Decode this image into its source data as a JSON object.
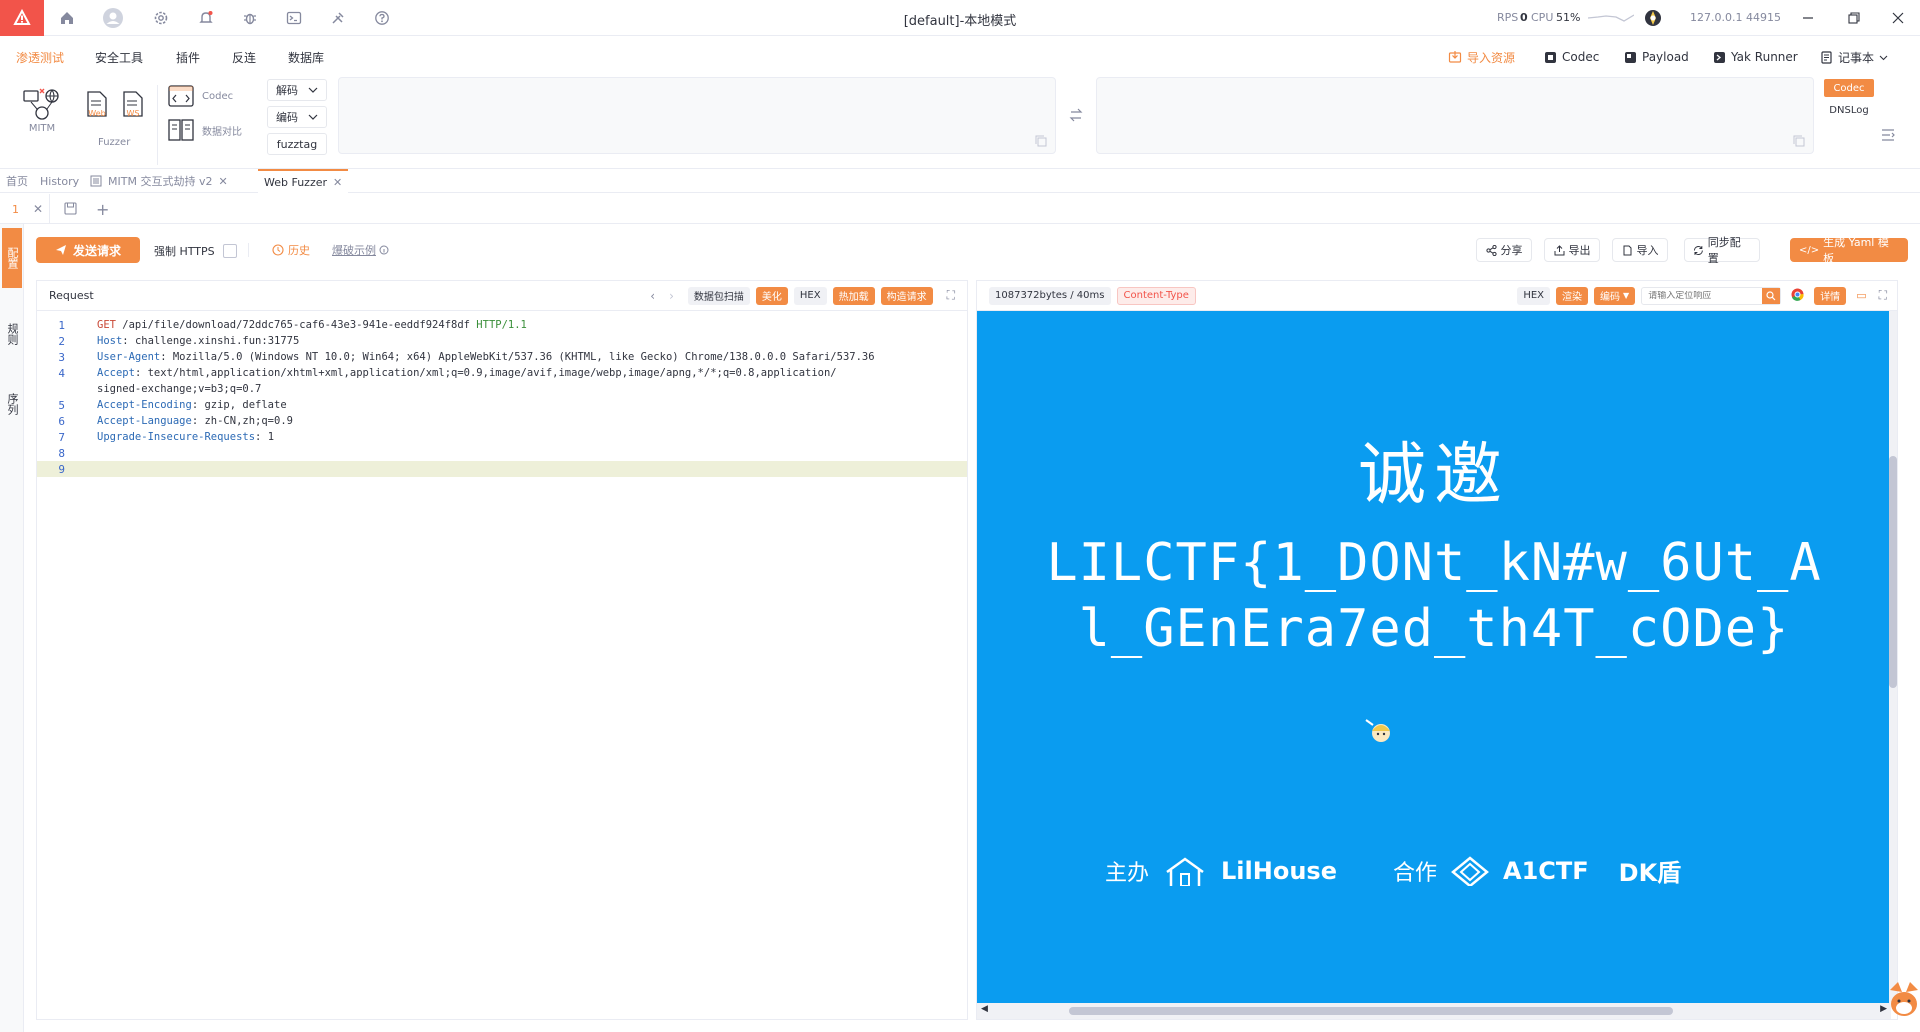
{
  "window": {
    "title": "[default]-本地模式",
    "rps_label": "RPS",
    "rps_value": "0",
    "cpu_label": "CPU",
    "cpu_value": "51%",
    "ip_port": "127.0.0.1 44915"
  },
  "menu": {
    "items": [
      "渗透测试",
      "安全工具",
      "插件",
      "反连",
      "数据库"
    ],
    "right": [
      "导入资源",
      "Codec",
      "Payload",
      "Yak Runner",
      "记事本"
    ]
  },
  "toolbar": {
    "mitm_label": "MITM",
    "web_label": "Web",
    "ws_label": "WS",
    "fuzzer_label": "Fuzzer",
    "codec_label": "Codec",
    "compare_label": "数据对比",
    "decode_label": "解码",
    "encode_label": "编码",
    "fuzztag_label": "fuzztag",
    "codec_tag": "Codec",
    "dnslog_tag": "DNSLog"
  },
  "page_tabs": [
    "首页",
    "History",
    "MITM 交互式劫持 v2",
    "Web Fuzzer"
  ],
  "sub_tabs": {
    "current": "1"
  },
  "sidebar": [
    "配置",
    "规则",
    "序列"
  ],
  "actions": {
    "send": "发送请求",
    "force_https": "强制 HTTPS",
    "history": "历史",
    "blast_example": "爆破示例",
    "share": "分享",
    "export": "导出",
    "import": "导入",
    "sync_config": "同步配置",
    "gen_yaml": "生成 Yaml 模板"
  },
  "request": {
    "title": "Request",
    "tags": [
      "数据包扫描",
      "美化",
      "HEX",
      "热加载",
      "构造请求"
    ],
    "lines": [
      {
        "n": "1",
        "key": "GET",
        "val": " /api/file/download/72ddc765-caf6-43e3-941e-eeddf924f8df ",
        "extra": "HTTP/1.1"
      },
      {
        "n": "2",
        "key": "Host",
        "val": ": challenge.xinshi.fun:31775",
        "extra": ""
      },
      {
        "n": "3",
        "key": "User-Agent",
        "val": ": Mozilla/5.0 (Windows NT 10.0; Win64; x64) AppleWebKit/537.36 (KHTML, like Gecko) Chrome/138.0.0.0 Safari/537.36",
        "extra": ""
      },
      {
        "n": "4",
        "key": "Accept",
        "val": ": text/html,application/xhtml+xml,application/xml;q=0.9,image/avif,image/webp,image/apng,*/*;q=0.8,application/",
        "extra": ""
      },
      {
        "n": "",
        "key": "",
        "val": "signed-exchange;v=b3;q=0.7",
        "extra": ""
      },
      {
        "n": "5",
        "key": "Accept-Encoding",
        "val": ": gzip, deflate",
        "extra": ""
      },
      {
        "n": "6",
        "key": "Accept-Language",
        "val": ": zh-CN,zh;q=0.9",
        "extra": ""
      },
      {
        "n": "7",
        "key": "Upgrade-Insecure-Requests",
        "val": ": 1",
        "extra": ""
      },
      {
        "n": "8",
        "key": "",
        "val": "",
        "extra": ""
      },
      {
        "n": "9",
        "key": "",
        "val": "",
        "extra": ""
      }
    ]
  },
  "response": {
    "stats": "1087372bytes / 40ms",
    "content_type": "Content-Type",
    "hex": "HEX",
    "render": "渲染",
    "encode": "编码",
    "search_placeholder": "请输入定位响应",
    "details": "详情",
    "heading": "诚邀",
    "flag_line1": "LILCTF{1_DONt_kN#w_6Ut_A",
    "flag_line2": "l_GEnEra7ed_th4T_cODe}",
    "footer_host": "主办",
    "footer_host_name": "LilHouse",
    "footer_coop": "合作",
    "footer_coop_name": "A1CTF",
    "footer_dk": "DK盾"
  },
  "colors": {
    "accent": "#f28b44",
    "danger": "#f2544a",
    "resp_bg": "#0a9cf0"
  }
}
